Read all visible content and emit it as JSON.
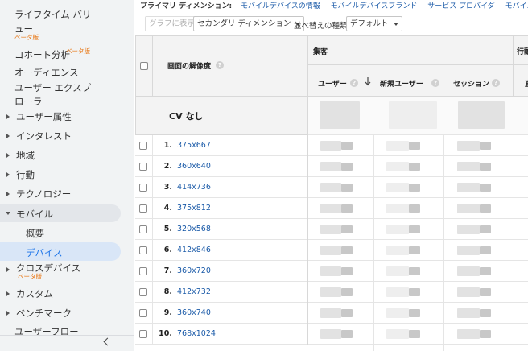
{
  "sidebar": {
    "items": [
      {
        "label": "ライフタイム バリ",
        "label2": "ュー",
        "beta": "ベータ版"
      },
      {
        "label": "コホート分析",
        "beta": "ベータ版"
      },
      {
        "label": "オーディエンス"
      },
      {
        "label": "ユーザー エクスプ",
        "label2": "ローラ"
      },
      {
        "label": "ユーザー属性"
      },
      {
        "label": "インタレスト"
      },
      {
        "label": "地域"
      },
      {
        "label": "行動"
      },
      {
        "label": "テクノロジー"
      },
      {
        "label": "モバイル"
      },
      {
        "label": "概要"
      },
      {
        "label": "デバイス"
      },
      {
        "label": "クロスデバイス",
        "beta": "ベータ版"
      },
      {
        "label": "カスタム"
      },
      {
        "label": "ベンチマーク"
      },
      {
        "label": "ユーザーフロー"
      }
    ]
  },
  "dimensions": {
    "primary_label": "プライマリ ディメンション:",
    "links": [
      "モバイルデバイスの情報",
      "モバイルデバイスブランド",
      "サービス プロバイダ",
      "モバイル入力セレクタ"
    ]
  },
  "toolbar": {
    "graph_btn": "グラフに表示",
    "secondary_dim": "セカンダリ ディメンション",
    "sort_label": "並べ替えの種類:",
    "sort_value": "デフォルト"
  },
  "table": {
    "dim_header": "画面の解像度",
    "group_acq": "集客",
    "group_behavior": "行動",
    "col_users": "ユーザー",
    "col_new_users": "新規ユーザー",
    "col_sessions": "セッション",
    "col_behavior_trunc": "直",
    "cv_label": "CV なし",
    "rows": [
      {
        "num": "1.",
        "res": "375x667"
      },
      {
        "num": "2.",
        "res": "360x640"
      },
      {
        "num": "3.",
        "res": "414x736"
      },
      {
        "num": "4.",
        "res": "375x812"
      },
      {
        "num": "5.",
        "res": "320x568"
      },
      {
        "num": "6.",
        "res": "412x846"
      },
      {
        "num": "7.",
        "res": "360x720"
      },
      {
        "num": "8.",
        "res": "412x732"
      },
      {
        "num": "9.",
        "res": "360x740"
      },
      {
        "num": "10.",
        "res": "768x1024"
      }
    ]
  }
}
